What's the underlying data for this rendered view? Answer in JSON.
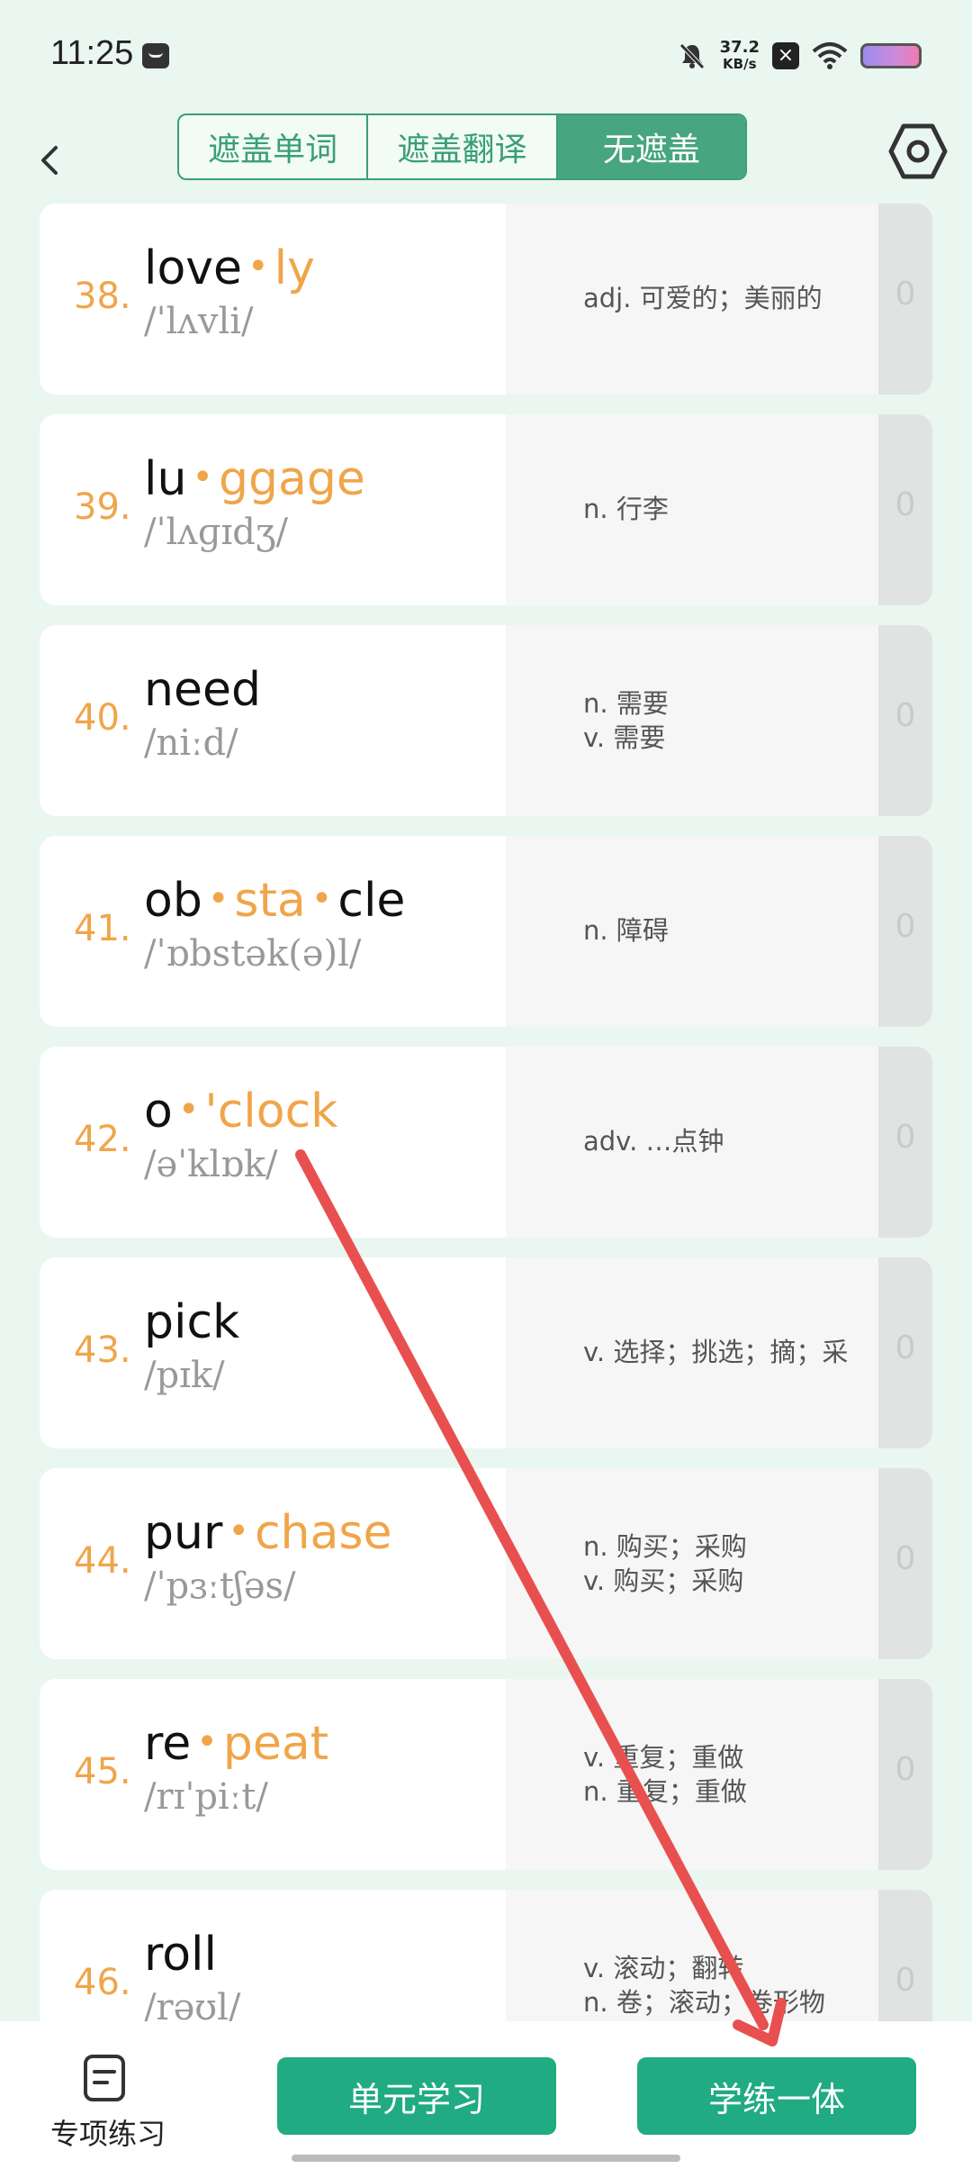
{
  "status": {
    "time": "11:25",
    "net_speed_value": "37.2",
    "net_speed_unit": "KB/s"
  },
  "tabs": [
    {
      "label": "遮盖单词"
    },
    {
      "label": "遮盖翻译"
    },
    {
      "label": "无遮盖",
      "active": true
    }
  ],
  "words": [
    {
      "index": "38.",
      "parts": [
        "love",
        "ly"
      ],
      "highlight": [
        1
      ],
      "phonetic": "/ˈlʌvli/",
      "meanings": [
        "adj. 可爱的；美丽的"
      ],
      "count": "0"
    },
    {
      "index": "39.",
      "parts": [
        "lu",
        "ggage"
      ],
      "highlight": [
        1
      ],
      "phonetic": "/ˈlʌɡɪdʒ/",
      "meanings": [
        "n. 行李"
      ],
      "count": "0"
    },
    {
      "index": "40.",
      "parts": [
        "need"
      ],
      "highlight": [],
      "phonetic": "/niːd/",
      "meanings": [
        "n. 需要",
        "v. 需要"
      ],
      "count": "0"
    },
    {
      "index": "41.",
      "parts": [
        "ob",
        "sta",
        "cle"
      ],
      "highlight": [
        1
      ],
      "phonetic": "/ˈɒbstək(ə)l/",
      "meanings": [
        "n. 障碍"
      ],
      "count": "0"
    },
    {
      "index": "42.",
      "parts": [
        "o",
        "'clock"
      ],
      "highlight": [
        1
      ],
      "phonetic": "/əˈklɒk/",
      "meanings": [
        "adv. …点钟"
      ],
      "count": "0"
    },
    {
      "index": "43.",
      "parts": [
        "pick"
      ],
      "highlight": [],
      "phonetic": "/pɪk/",
      "meanings": [
        "v. 选择；挑选；摘；采"
      ],
      "count": "0"
    },
    {
      "index": "44.",
      "parts": [
        "pur",
        "chase"
      ],
      "highlight": [
        1
      ],
      "phonetic": "/ˈpɜːtʃəs/",
      "meanings": [
        "n. 购买；采购",
        "v. 购买；采购"
      ],
      "count": "0"
    },
    {
      "index": "45.",
      "parts": [
        "re",
        "peat"
      ],
      "highlight": [
        1
      ],
      "phonetic": "/rɪˈpiːt/",
      "meanings": [
        "v. 重复；重做",
        "n. 重复；重做"
      ],
      "count": "0"
    },
    {
      "index": "46.",
      "parts": [
        "roll"
      ],
      "highlight": [],
      "phonetic": "/rəʊl/",
      "meanings": [
        "v. 滚动；翻转",
        "n. 卷；滚动；卷形物"
      ],
      "count": "0"
    }
  ],
  "bottom": {
    "special_label": "专项练习",
    "unit_label": "单元学习",
    "practice_label": "学练一体"
  },
  "colors": {
    "accent_green": "#47a57f",
    "button_green": "#20ab82",
    "highlight_orange": "#f0a54a",
    "arrow_red": "#e8504f"
  }
}
